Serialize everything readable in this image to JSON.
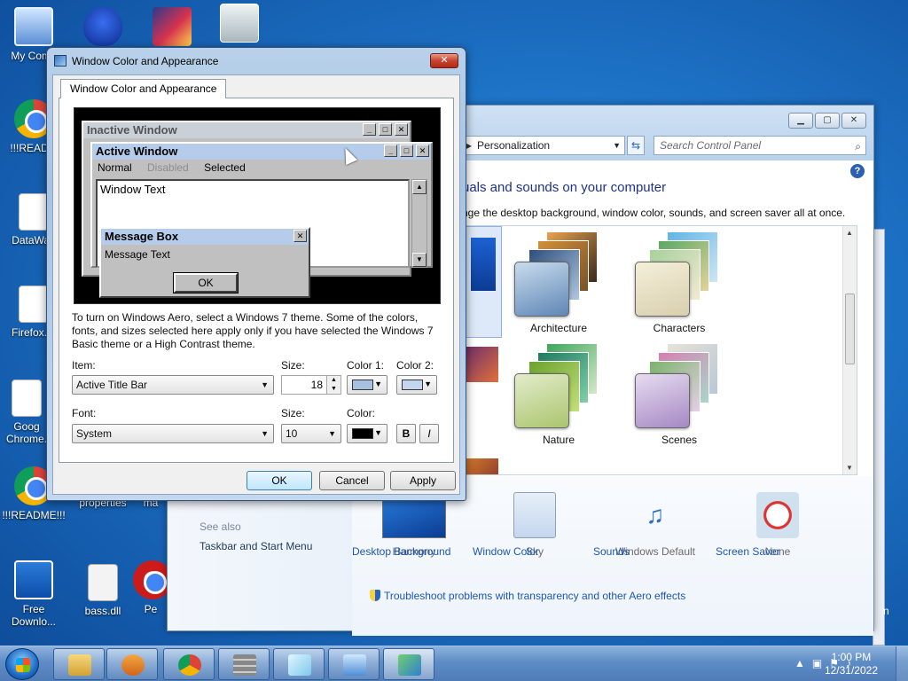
{
  "desktop": {
    "icons": [
      {
        "label": "My Comp",
        "icon": "computer-icon"
      },
      {
        "label": "",
        "icon": "malwarebytes-icon"
      },
      {
        "label": "",
        "icon": "image-icon"
      },
      {
        "label": "",
        "icon": "recycle-bin-icon"
      },
      {
        "label": "!!!READM",
        "icon": "chrome-icon"
      },
      {
        "label": "DataWag",
        "icon": "file-icon"
      },
      {
        "label": "Firefox.In",
        "icon": "file-icon"
      },
      {
        "label": "Goog Chrome.",
        "icon": "file-icon"
      },
      {
        "label": "!!!README!!!",
        "icon": "chrome-icon"
      },
      {
        "label": "properties",
        "icon": "file-icon"
      },
      {
        "label": "ma",
        "icon": "file-icon"
      },
      {
        "label": "Free Downlo...",
        "icon": "download-icon"
      },
      {
        "label": "bass.dll",
        "icon": "dll-icon"
      },
      {
        "label": "Pe",
        "icon": "opera-icon"
      }
    ]
  },
  "control_panel": {
    "address": "Personalization",
    "search_placeholder": "Search Control Panel",
    "heading": "uals and sounds on your computer",
    "subheading": "nge the desktop background, window color, sounds, and screen saver all at once.",
    "themes": [
      {
        "name": "Architecture"
      },
      {
        "name": "Characters"
      },
      {
        "name": "Nature"
      },
      {
        "name": "Scenes"
      }
    ],
    "bottom_items": [
      {
        "label": "Desktop Background",
        "value": "Harmony"
      },
      {
        "label": "Window Color",
        "value": "Sky"
      },
      {
        "label": "Sounds",
        "value": "Windows Default"
      },
      {
        "label": "Screen Saver",
        "value": "None"
      }
    ],
    "trouble_link": "Troubleshoot problems with transparency and other Aero effects",
    "see_also": "See also",
    "see_also_link": "Taskbar and Start Menu"
  },
  "dialog": {
    "title": "Window Color and Appearance",
    "tab": "Window Color and Appearance",
    "preview": {
      "inactive_title": "Inactive Window",
      "active_title": "Active Window",
      "menu_normal": "Normal",
      "menu_disabled": "Disabled",
      "menu_selected": "Selected",
      "window_text": "Window Text",
      "msgbox_title": "Message Box",
      "msgbox_text": "Message Text",
      "msgbox_ok": "OK"
    },
    "info_text": "To turn on Windows Aero, select a Windows 7 theme.  Some of the colors, fonts, and sizes selected here apply only if you have selected the Windows 7 Basic theme or a High Contrast theme.",
    "item_label": "Item:",
    "item_value": "Active Title Bar",
    "size_label": "Size:",
    "size_value": "18",
    "color1_label": "Color 1:",
    "color2_label": "Color 2:",
    "color1": "#a9c1e0",
    "color2": "#c3d6ee",
    "font_label": "Font:",
    "font_value": "System",
    "font_size_label": "Size:",
    "font_size_value": "10",
    "font_color_label": "Color:",
    "font_color": "#000000",
    "bold": "B",
    "italic": "I",
    "ok": "OK",
    "cancel": "Cancel",
    "apply": "Apply"
  },
  "taskbar": {
    "time": "1:00 PM",
    "date": "12/31/2022"
  }
}
